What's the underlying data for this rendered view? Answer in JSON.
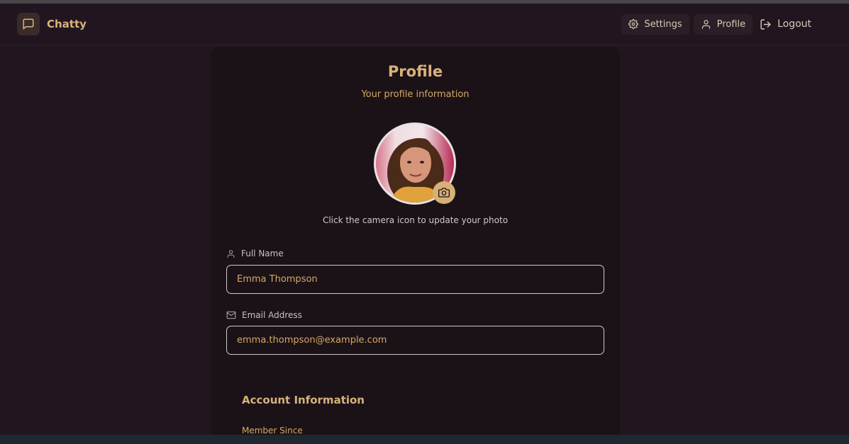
{
  "app": {
    "name": "Chatty"
  },
  "nav": {
    "settings": "Settings",
    "profile": "Profile",
    "logout": "Logout"
  },
  "profile": {
    "title": "Profile",
    "subtitle": "Your profile information",
    "photo_hint": "Click the camera icon to update your photo",
    "full_name_label": "Full Name",
    "full_name_value": "Emma Thompson",
    "email_label": "Email Address",
    "email_value": "emma.thompson@example.com"
  },
  "account": {
    "title": "Account Information",
    "member_since_label": "Member Since"
  },
  "colors": {
    "accent": "#d9b27a",
    "background": "#21161f",
    "card": "#1b1218"
  },
  "icons": {
    "logo": "message-square-icon",
    "settings": "gear-icon",
    "profile": "user-icon",
    "logout": "logout-icon",
    "camera": "camera-icon",
    "name": "user-icon",
    "email": "mail-icon"
  }
}
